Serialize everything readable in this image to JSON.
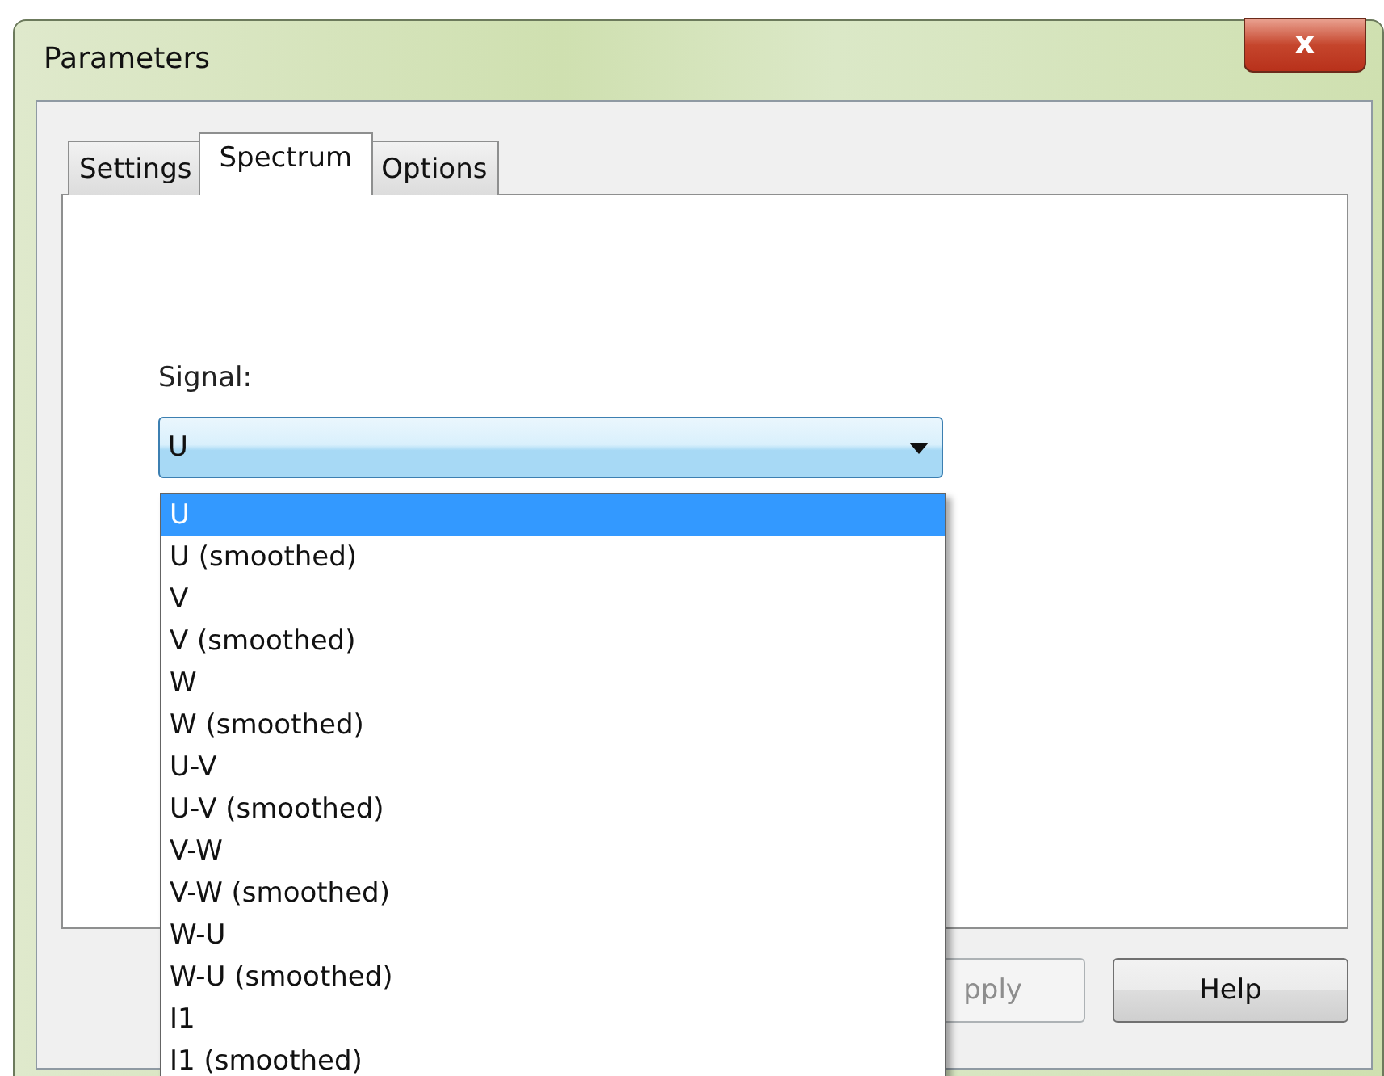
{
  "window": {
    "title": "Parameters",
    "close_label": "x"
  },
  "tabs": [
    {
      "label": "Settings",
      "selected": false
    },
    {
      "label": "Spectrum",
      "selected": true
    },
    {
      "label": "Options",
      "selected": false
    }
  ],
  "signal": {
    "label": "Signal:",
    "value": "U",
    "expanded": true,
    "options": [
      {
        "label": "U",
        "selected": true
      },
      {
        "label": "U (smoothed)",
        "selected": false
      },
      {
        "label": "V",
        "selected": false
      },
      {
        "label": "V (smoothed)",
        "selected": false
      },
      {
        "label": "W",
        "selected": false
      },
      {
        "label": "W (smoothed)",
        "selected": false
      },
      {
        "label": "U-V",
        "selected": false
      },
      {
        "label": "U-V (smoothed)",
        "selected": false
      },
      {
        "label": "V-W",
        "selected": false
      },
      {
        "label": "V-W (smoothed)",
        "selected": false
      },
      {
        "label": "W-U",
        "selected": false
      },
      {
        "label": "W-U (smoothed)",
        "selected": false
      },
      {
        "label": "I1",
        "selected": false
      },
      {
        "label": "I1 (smoothed)",
        "selected": false
      }
    ]
  },
  "buttons": [
    {
      "label": "pply",
      "disabled": true
    },
    {
      "label": "Help",
      "disabled": false
    }
  ]
}
